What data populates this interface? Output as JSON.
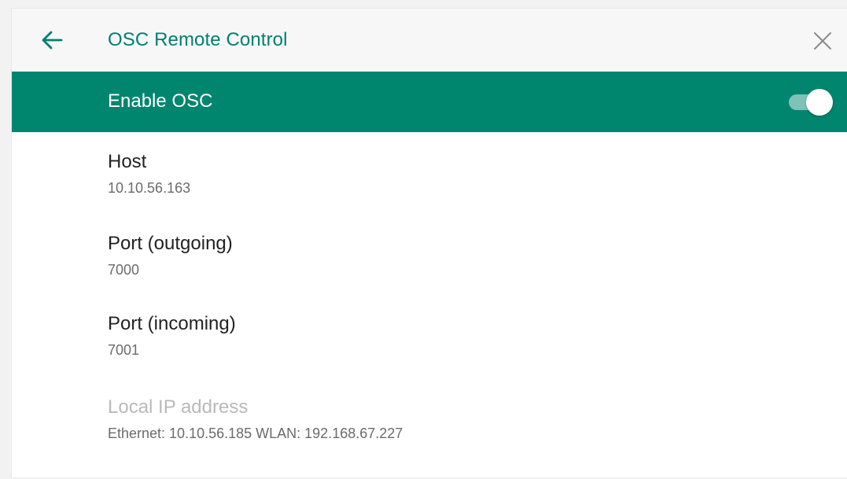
{
  "header": {
    "title": "OSC Remote Control",
    "back_icon": "arrow-left-icon",
    "close_icon": "close-icon",
    "accent_color": "#00806f"
  },
  "enable": {
    "label": "Enable OSC",
    "checked": true,
    "bar_color": "#00856f"
  },
  "prefs": {
    "host": {
      "title": "Host",
      "value": "10.10.56.163"
    },
    "port_out": {
      "title": "Port (outgoing)",
      "value": "7000"
    },
    "port_in": {
      "title": "Port (incoming)",
      "value": "7001"
    },
    "local_ip": {
      "title": "Local IP address",
      "value": "Ethernet: 10.10.56.185 WLAN: 192.168.67.227"
    }
  }
}
